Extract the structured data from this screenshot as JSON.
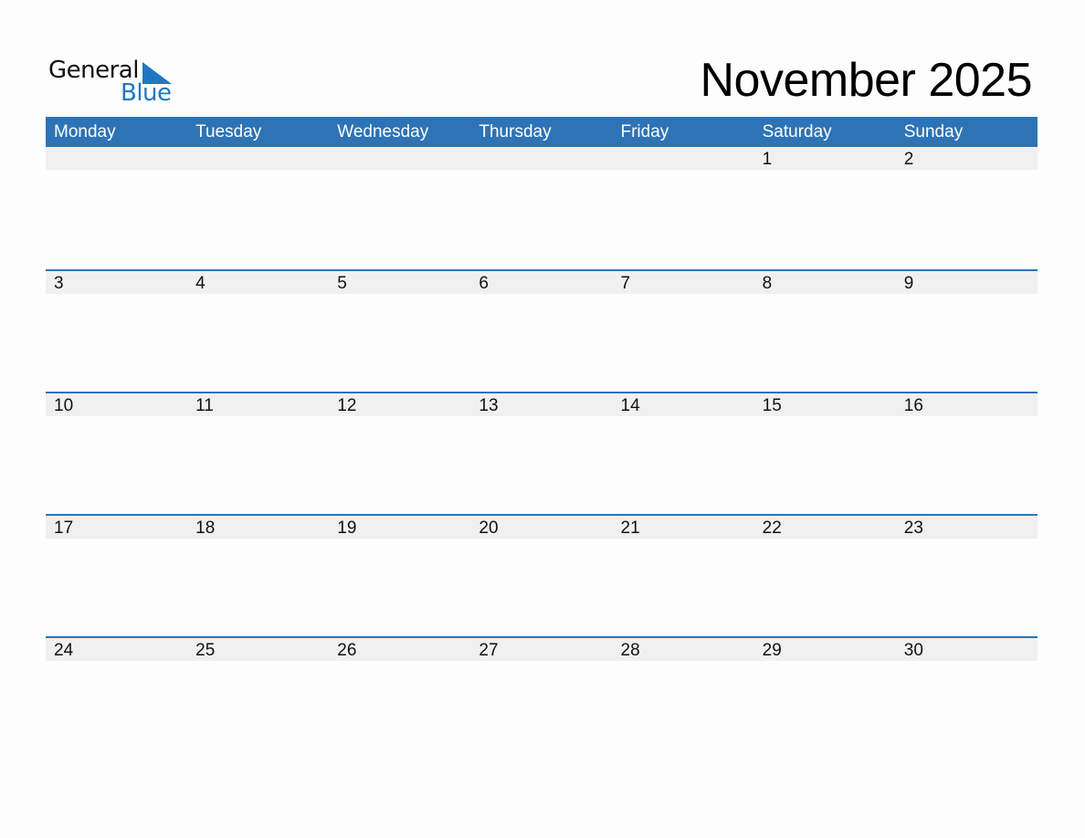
{
  "logo": {
    "line1": "General",
    "line2": "Blue"
  },
  "title": "November 2025",
  "weekdays": [
    "Monday",
    "Tuesday",
    "Wednesday",
    "Thursday",
    "Friday",
    "Saturday",
    "Sunday"
  ],
  "weeks": [
    [
      "",
      "",
      "",
      "",
      "",
      "1",
      "2"
    ],
    [
      "3",
      "4",
      "5",
      "6",
      "7",
      "8",
      "9"
    ],
    [
      "10",
      "11",
      "12",
      "13",
      "14",
      "15",
      "16"
    ],
    [
      "17",
      "18",
      "19",
      "20",
      "21",
      "22",
      "23"
    ],
    [
      "24",
      "25",
      "26",
      "27",
      "28",
      "29",
      "30"
    ]
  ],
  "colors": {
    "accent": "#2e73b5",
    "logo_blue": "#1f77c4",
    "date_strip": "#f0f0f0"
  }
}
